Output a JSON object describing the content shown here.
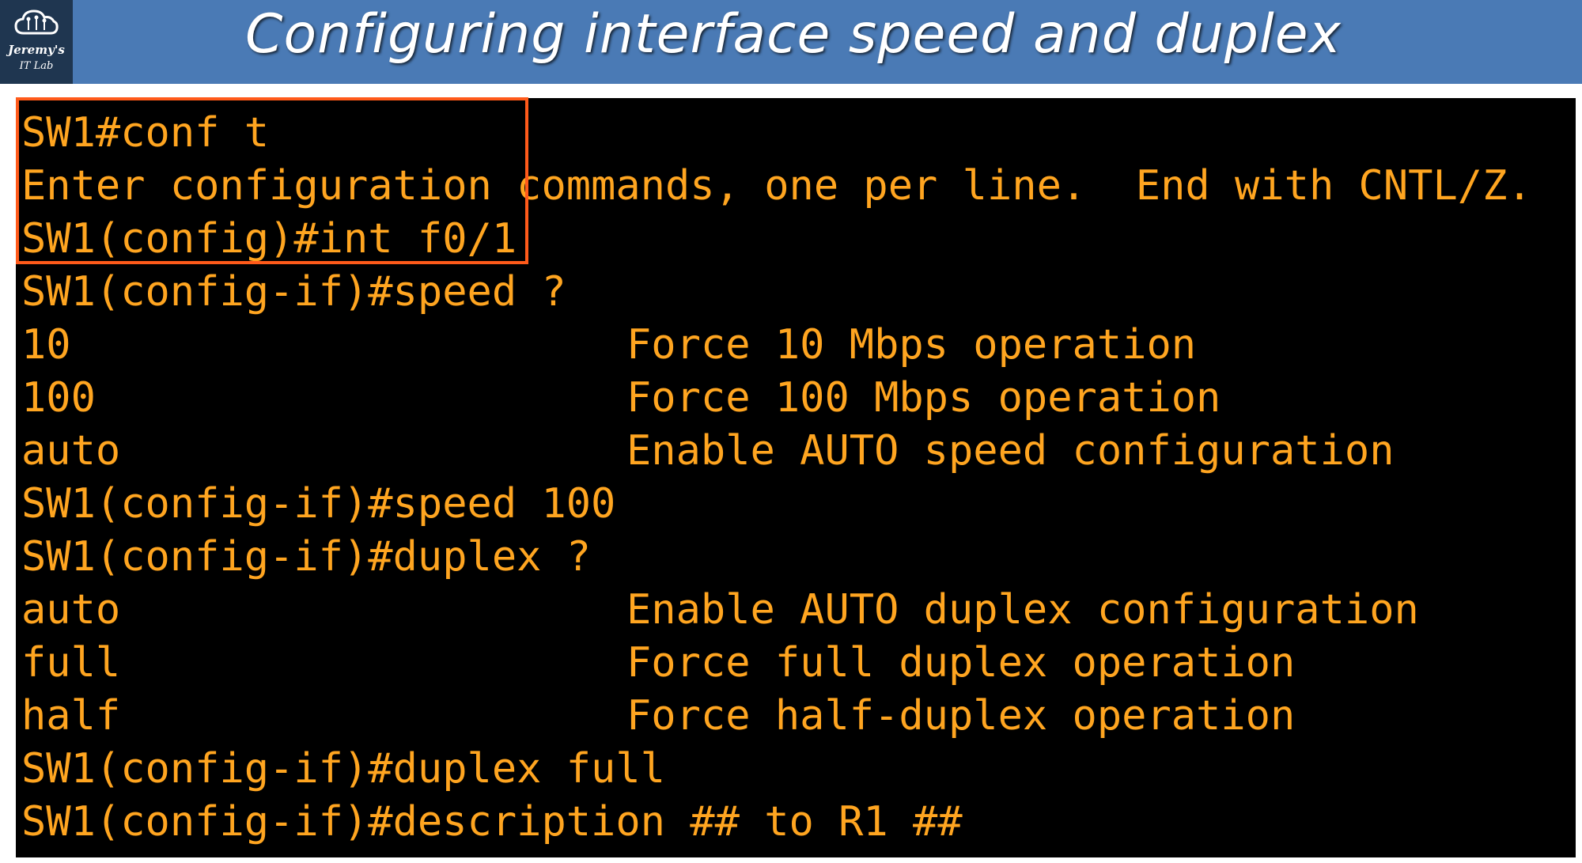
{
  "header": {
    "title": "Configuring interface speed and duplex",
    "logo": {
      "line1": "Jeremy's",
      "line2": "IT Lab",
      "icon": "cloud-circuit-icon"
    },
    "background_color": "#4a7ab5"
  },
  "terminal": {
    "text_color": "#ffa520",
    "background_color": "#000000",
    "highlight_color": "#ff5a1a",
    "lines": [
      {
        "cmd": "SW1#conf t",
        "desc": ""
      },
      {
        "cmd": "Enter configuration commands, one per line.  End with CNTL/Z.",
        "desc": ""
      },
      {
        "cmd": "SW1(config)#int f0/1",
        "desc": ""
      },
      {
        "cmd": "SW1(config-if)#speed ?",
        "desc": ""
      },
      {
        "cmd": "10",
        "desc": "Force 10 Mbps operation"
      },
      {
        "cmd": "100",
        "desc": "Force 100 Mbps operation"
      },
      {
        "cmd": "auto",
        "desc": "Enable AUTO speed configuration"
      },
      {
        "cmd": "SW1(config-if)#speed 100",
        "desc": ""
      },
      {
        "cmd": "SW1(config-if)#duplex ?",
        "desc": ""
      },
      {
        "cmd": "auto",
        "desc": "Enable AUTO duplex configuration"
      },
      {
        "cmd": "full",
        "desc": "Force full duplex operation"
      },
      {
        "cmd": "half",
        "desc": "Force half-duplex operation"
      },
      {
        "cmd": "SW1(config-if)#duplex full",
        "desc": ""
      },
      {
        "cmd": "SW1(config-if)#description ## to R1 ##",
        "desc": ""
      }
    ]
  }
}
